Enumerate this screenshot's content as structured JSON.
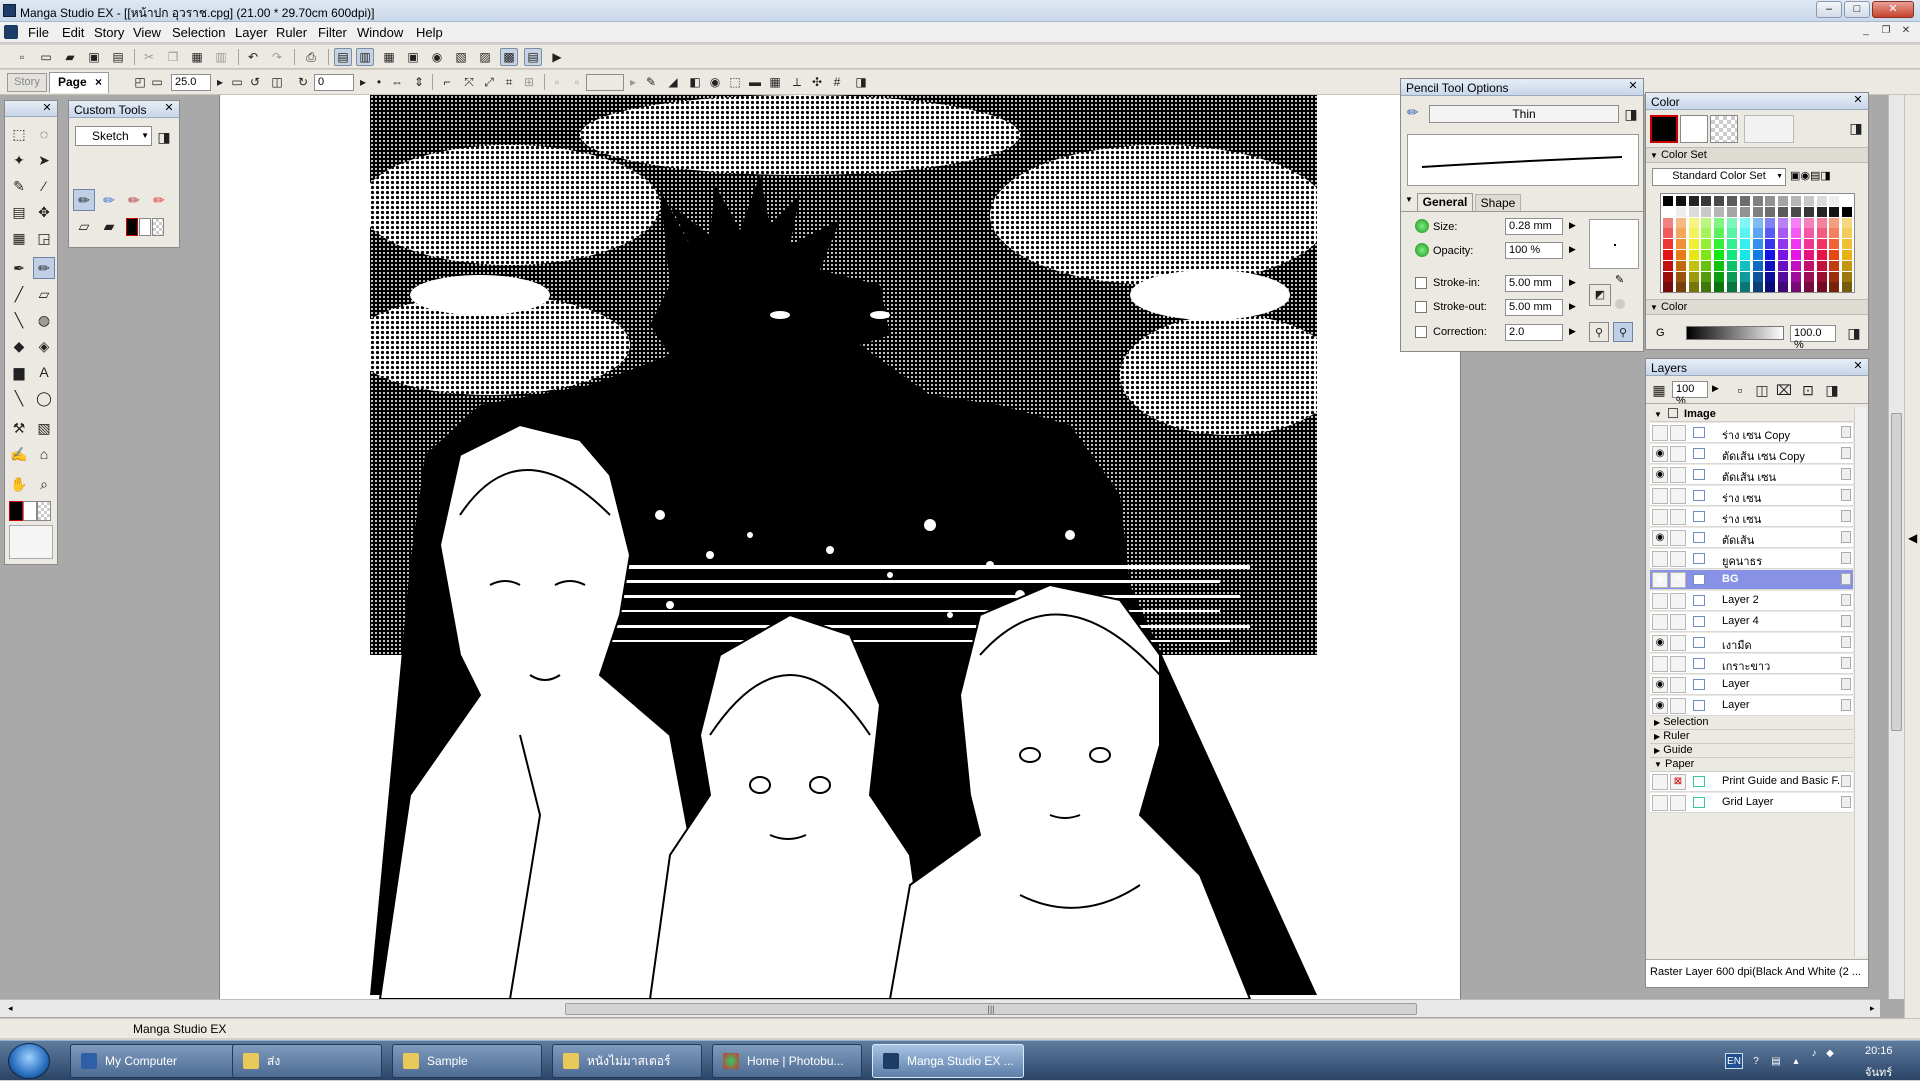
{
  "window": {
    "title": "Manga Studio EX - [[หน้าปก อุวราช.cpg] (21.00 * 29.70cm 600dpi)]"
  },
  "menu": [
    "File",
    "Edit",
    "Story",
    "View",
    "Selection",
    "Layer",
    "Ruler",
    "Filter",
    "Window",
    "Help"
  ],
  "toolbar2": {
    "tab_story": "Story",
    "tab_page": "Page",
    "tab_page_close": "×",
    "zoom_value": "25.0",
    "rotation_value": "0"
  },
  "custom_tools": {
    "title": "Custom Tools",
    "preset": "Sketch"
  },
  "pencil_options": {
    "title": "Pencil Tool Options",
    "brush_name": "Thin",
    "tabs": [
      "General",
      "Shape"
    ],
    "size_label": "Size:",
    "size_value": "0.28 mm",
    "opacity_label": "Opacity:",
    "opacity_value": "100 %",
    "stroke_in_label": "Stroke-in:",
    "stroke_in_value": "5.00 mm",
    "stroke_out_label": "Stroke-out:",
    "stroke_out_value": "5.00 mm",
    "correction_label": "Correction:",
    "correction_value": "2.0"
  },
  "color_panel": {
    "title": "Color",
    "color_set_header": "Color Set",
    "color_set_name": "Standard Color Set",
    "color_header": "Color",
    "channel_label": "G",
    "channel_value": "100.0 %"
  },
  "layers_panel": {
    "title": "Layers",
    "opacity": "100 %",
    "group_image": "Image",
    "layers": [
      {
        "name": "ร่าง เซน  Copy",
        "visible": false,
        "selected": false
      },
      {
        "name": "ตัดเส้น เซน Copy",
        "visible": true,
        "selected": false
      },
      {
        "name": "ตัดเส้น เซน",
        "visible": true,
        "selected": false
      },
      {
        "name": "ร่าง เซน",
        "visible": false,
        "selected": false
      },
      {
        "name": "ร่าง เซน",
        "visible": false,
        "selected": false
      },
      {
        "name": "ตัดเส้น",
        "visible": true,
        "selected": false
      },
      {
        "name": "ยูคนาธร",
        "visible": false,
        "selected": false
      },
      {
        "name": "BG",
        "visible": true,
        "selected": true
      },
      {
        "name": "Layer 2",
        "visible": false,
        "selected": false
      },
      {
        "name": "Layer 4",
        "visible": false,
        "selected": false
      },
      {
        "name": "เงามืด",
        "visible": true,
        "selected": false
      },
      {
        "name": "เกราะขาว",
        "visible": false,
        "selected": false
      },
      {
        "name": "Layer",
        "visible": true,
        "selected": false
      },
      {
        "name": "Layer",
        "visible": true,
        "selected": false
      }
    ],
    "groups": [
      "Selection",
      "Ruler",
      "Guide",
      "Paper"
    ],
    "paper_layers": [
      "Print Guide and Basic F...",
      "Grid Layer"
    ],
    "status": "Raster Layer 600 dpi(Black And White (2 ..."
  },
  "statusbar": {
    "text": "Manga Studio EX"
  },
  "taskbar": {
    "tasks": [
      {
        "label": "My Computer",
        "active": false
      },
      {
        "label": "ส่ง",
        "active": false
      },
      {
        "label": "Sample",
        "active": false
      },
      {
        "label": "หนังไม่มาสเตอร์",
        "active": false
      },
      {
        "label": "Home | Photobu...",
        "active": false
      },
      {
        "label": "Manga Studio EX ...",
        "active": true
      }
    ],
    "lang": "EN",
    "time": "20:16",
    "day": "จันทร์"
  },
  "colors": {
    "accent": "#8792e6",
    "title_bg": "#c8d6ea",
    "panel_bg": "#ece9e2",
    "workspace": "#a9a9a9"
  }
}
